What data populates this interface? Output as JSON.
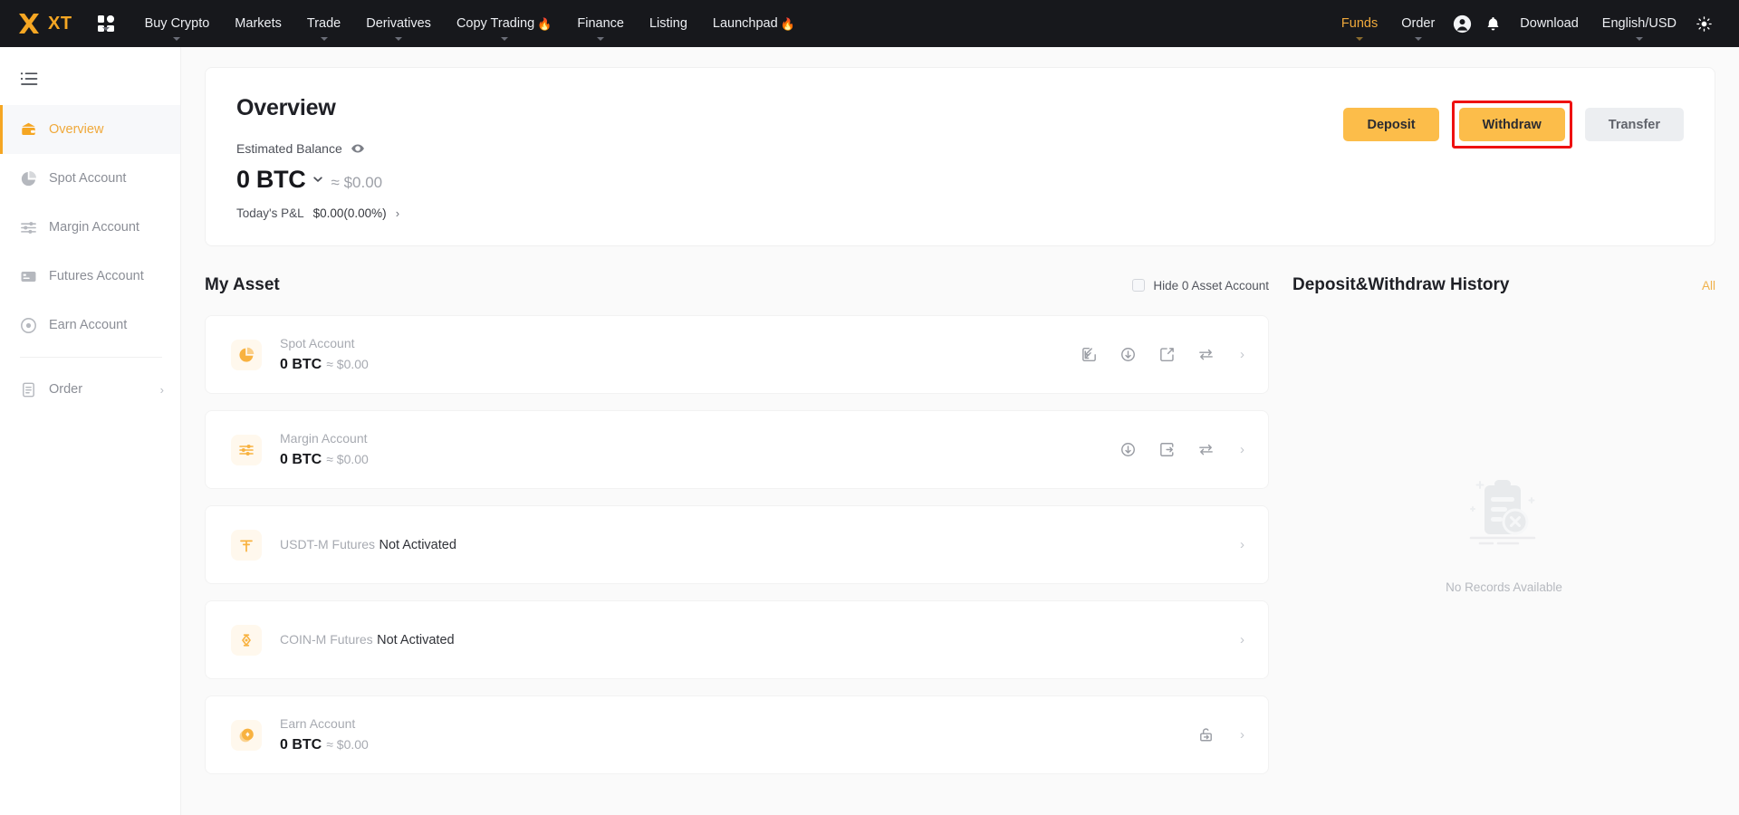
{
  "brand": {
    "name": "XT",
    "logo_icon": "xt-logo-icon",
    "accent": "#f5a623"
  },
  "topnav": {
    "apps_icon": "grid-apps-icon",
    "left_items": [
      {
        "label": "Buy Crypto",
        "has_caret": true,
        "flame": ""
      },
      {
        "label": "Markets",
        "has_caret": false,
        "flame": ""
      },
      {
        "label": "Trade",
        "has_caret": true,
        "flame": ""
      },
      {
        "label": "Derivatives",
        "has_caret": true,
        "flame": ""
      },
      {
        "label": "Copy Trading",
        "has_caret": true,
        "flame": "🔥"
      },
      {
        "label": "Finance",
        "has_caret": true,
        "flame": ""
      },
      {
        "label": "Listing",
        "has_caret": false,
        "flame": ""
      },
      {
        "label": "Launchpad",
        "has_caret": false,
        "flame": "🔥"
      }
    ],
    "right_items": [
      {
        "label": "Funds",
        "has_caret": true,
        "accent": true
      },
      {
        "label": "Order",
        "has_caret": true,
        "accent": false
      }
    ],
    "user_icon": "user-avatar-icon",
    "bell_icon": "notification-bell-icon",
    "download_label": "Download",
    "locale_label": "English/USD",
    "theme_icon": "theme-brightness-icon"
  },
  "sidebar": {
    "collapse_icon": "sidebar-collapse-icon",
    "items": [
      {
        "label": "Overview",
        "icon": "wallet-overview-icon",
        "active": true
      },
      {
        "label": "Spot Account",
        "icon": "pie-chart-icon",
        "active": false
      },
      {
        "label": "Margin Account",
        "icon": "sliders-icon",
        "active": false
      },
      {
        "label": "Futures Account",
        "icon": "futures-card-icon",
        "active": false
      },
      {
        "label": "Earn Account",
        "icon": "earn-coin-icon",
        "active": false
      }
    ],
    "order": {
      "label": "Order",
      "icon": "order-clipboard-icon",
      "chevron": "›"
    }
  },
  "overview": {
    "title": "Overview",
    "estimated_balance_label": "Estimated Balance",
    "eye_icon": "eye-visible-icon",
    "balance": "0 BTC",
    "balance_caret_icon": "chevron-down-icon",
    "balance_approx": "≈ $0.00",
    "pnl_label": "Today's P&L",
    "pnl_value": "$0.00(0.00%)",
    "pnl_chevron": "›",
    "buttons": {
      "deposit": "Deposit",
      "withdraw": "Withdraw",
      "transfer": "Transfer"
    },
    "highlight_color": "#ee1111",
    "highlighted_button": "Withdraw"
  },
  "my_asset": {
    "title": "My Asset",
    "hide_zero_label": "Hide 0 Asset Account",
    "hide_zero_checked": false,
    "rows": [
      {
        "name": "Spot Account",
        "icon": "pie-chart-icon",
        "value": "0 BTC",
        "approx": "≈ $0.00",
        "status": "",
        "actions": [
          "deposit-icon",
          "buy-crypto-icon",
          "withdraw-icon",
          "transfer-icon"
        ],
        "chevron": "›"
      },
      {
        "name": "Margin Account",
        "icon": "sliders-icon",
        "value": "0 BTC",
        "approx": "≈ $0.00",
        "status": "",
        "actions": [
          "buy-crypto-icon",
          "borrow-icon",
          "transfer-icon"
        ],
        "chevron": "›"
      },
      {
        "name": "USDT-M Futures",
        "icon": "usdt-futures-icon",
        "value": "",
        "approx": "",
        "status": "Not Activated",
        "actions": [],
        "chevron": "›"
      },
      {
        "name": "COIN-M Futures",
        "icon": "coin-futures-icon",
        "value": "",
        "approx": "",
        "status": "Not Activated",
        "actions": [],
        "chevron": "›"
      },
      {
        "name": "Earn Account",
        "icon": "earn-coin-icon",
        "value": "0 BTC",
        "approx": "≈ $0.00",
        "status": "",
        "actions": [
          "redeem-icon"
        ],
        "chevron": "›"
      }
    ]
  },
  "history": {
    "title": "Deposit&Withdraw History",
    "all_label": "All",
    "empty_icon": "empty-records-icon",
    "empty_text": "No Records Available"
  }
}
